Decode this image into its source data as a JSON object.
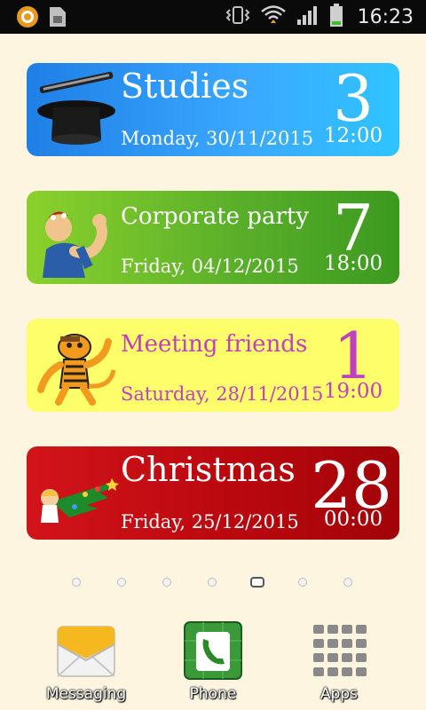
{
  "status_bar": {
    "time": "16:23",
    "icons": [
      "app-notification-icon",
      "sim-card-icon",
      "vibrate-icon",
      "wifi-icon",
      "signal-icon",
      "battery-icon"
    ]
  },
  "cards": [
    {
      "title": "Studies",
      "date": "Monday, 30/11/2015",
      "day": "3",
      "time": "12:00",
      "icon": "top-hat-icon",
      "color": "#2f9cff"
    },
    {
      "title": "Corporate party",
      "date": "Friday, 04/12/2015",
      "day": "7",
      "time": "18:00",
      "icon": "rosie-riveter-icon",
      "color": "#5bb02a"
    },
    {
      "title": "Meeting friends",
      "date": "Saturday, 28/11/2015",
      "day": "1",
      "time": "19:00",
      "icon": "tiger-icon",
      "color": "#fefe6a",
      "text_color": "#c040c0"
    },
    {
      "title": "Christmas",
      "date": "Friday, 25/12/2015",
      "day": "28",
      "time": "00:00",
      "icon": "christmas-tree-icon",
      "color": "#b8070e"
    }
  ],
  "page_indicator": {
    "count": 7,
    "active": 5
  },
  "dock": [
    {
      "label": "Messaging",
      "icon": "envelope-icon"
    },
    {
      "label": "Phone",
      "icon": "phone-icon"
    },
    {
      "label": "Apps",
      "icon": "apps-grid-icon"
    }
  ]
}
